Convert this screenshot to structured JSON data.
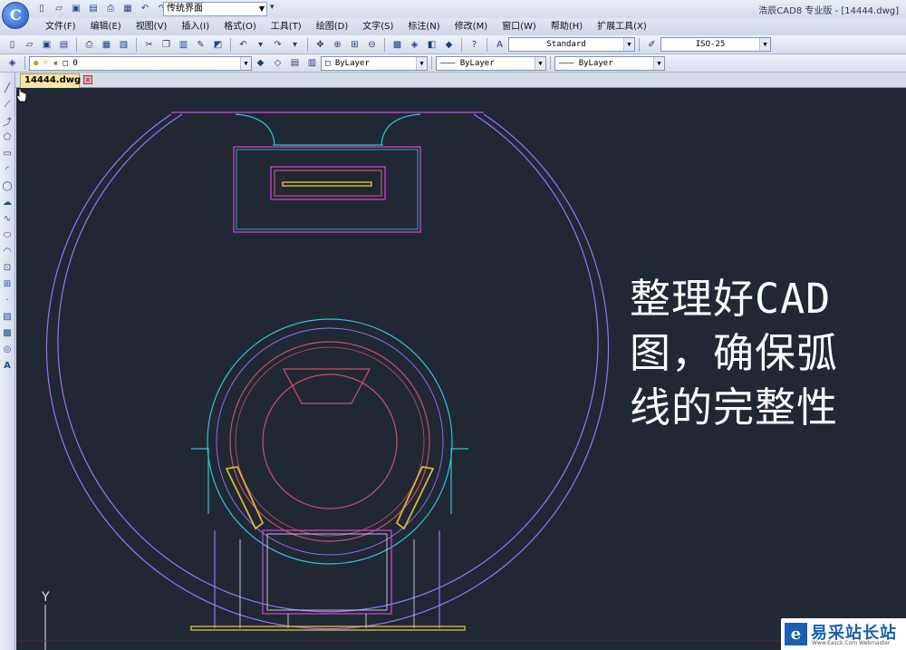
{
  "window": {
    "title": "浩辰CAD8 专业版 - [14444.dwg]",
    "logo_letter": "C"
  },
  "quick_access": {
    "workspace": "传统界面",
    "more_glyph": "▾"
  },
  "menu": {
    "items": [
      "文件(F)",
      "编辑(E)",
      "视图(V)",
      "插入(I)",
      "格式(O)",
      "工具(T)",
      "绘图(D)",
      "文字(S)",
      "标注(N)",
      "修改(M)",
      "窗口(W)",
      "帮助(H)",
      "扩展工具(X)"
    ]
  },
  "toolbar": {
    "text_style": "Standard",
    "dim_style": "ISO-25",
    "layer": "0",
    "color": "ByLayer",
    "linetype": "ByLayer",
    "lineweight": "ByLayer"
  },
  "document": {
    "tab_label": "14444.dwg",
    "close_glyph": "x"
  },
  "caption": {
    "lines": [
      "整理好CAD",
      "图，确保弧",
      "线的完整性"
    ]
  },
  "canvas": {
    "background": "#202833",
    "ucs_label": "Y"
  },
  "colors": {
    "outer_ring": "#9a73ff",
    "magenta": "#e040e8",
    "cyan": "#33c3d6",
    "red_circle": "#c8506a",
    "yellow": "#d9b43a",
    "white": "#e8e8f0"
  },
  "watermark": {
    "logo": "e",
    "text": "易采站长站",
    "sub": "Www.Easck.Com Webmaster"
  }
}
